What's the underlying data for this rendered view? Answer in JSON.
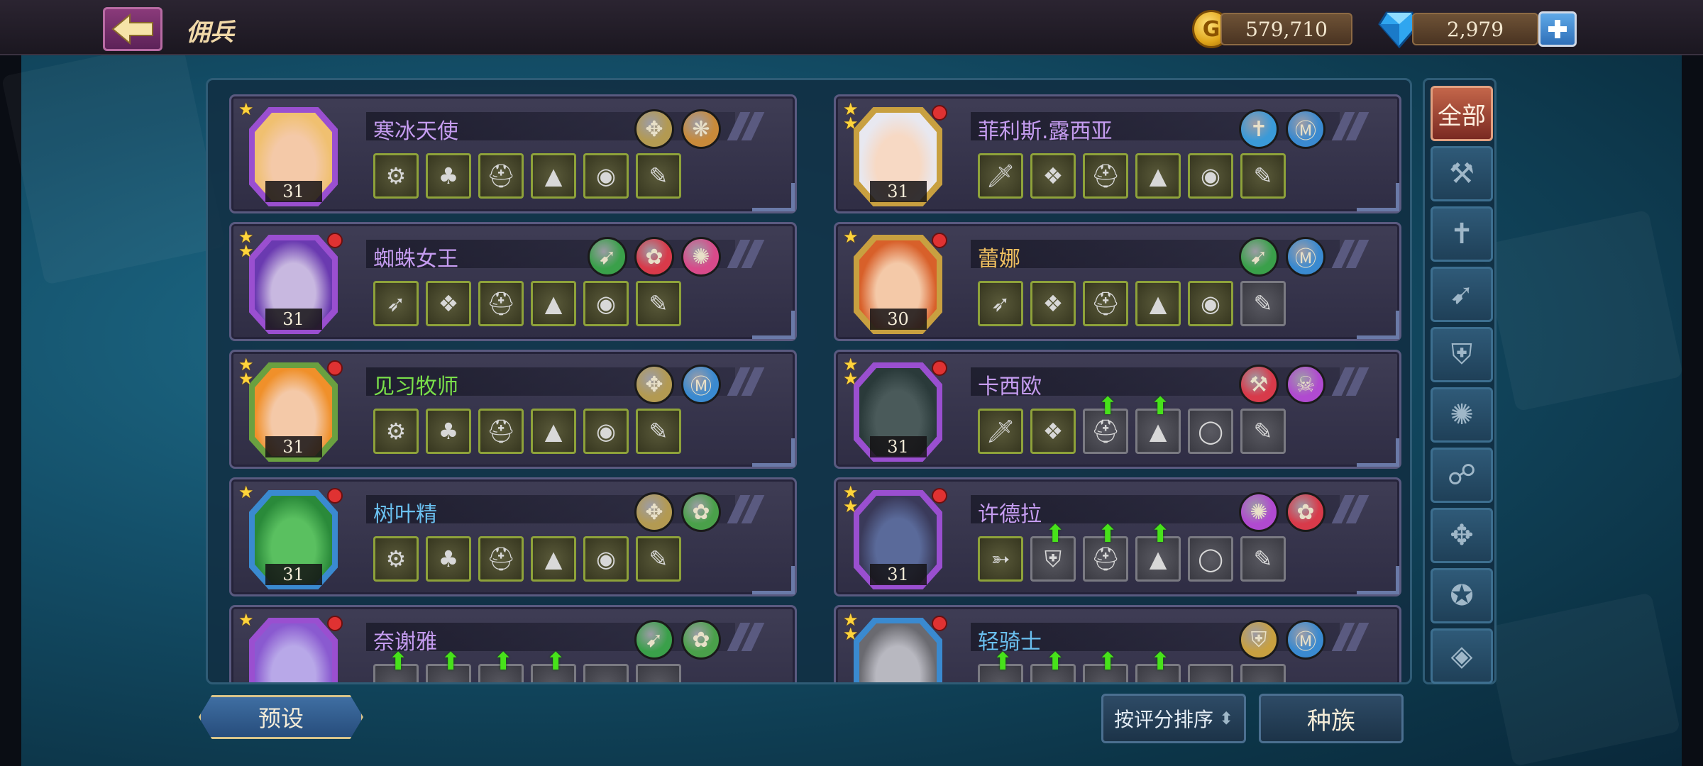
{
  "header": {
    "title": "佣兵",
    "gold": "579,710",
    "gems": "2,979",
    "coin_symbol": "G"
  },
  "heroes": [
    {
      "name": "寒冰天使",
      "level": "31",
      "name_color": "#c59cf0",
      "frame": "#9a4fd0",
      "face": "#f4c9a8",
      "hair": "#f0c070",
      "badges": [
        {
          "icon": "✥",
          "bg": "#b39a52"
        },
        {
          "icon": "❋",
          "bg": "#c88a3a"
        }
      ],
      "slots": [
        {
          "icon": "⚙",
          "up": false,
          "empty": false
        },
        {
          "icon": "♣",
          "up": false,
          "empty": false
        },
        {
          "icon": "⛑",
          "up": false,
          "empty": false
        },
        {
          "icon": "▲",
          "up": false,
          "empty": false
        },
        {
          "icon": "◉",
          "up": false,
          "empty": false
        },
        {
          "icon": "✎",
          "up": false,
          "empty": false
        }
      ]
    },
    {
      "name": "菲利斯.露西亚",
      "level": "31",
      "name_color": "#c59cf0",
      "frame": "#c8a040",
      "face": "#f7d9c4",
      "hair": "#e8e8f0",
      "badges": [
        {
          "icon": "✝",
          "bg": "#3a9ad8"
        },
        {
          "icon": "Ⓜ",
          "bg": "#3a8ad0"
        }
      ],
      "slots": [
        {
          "icon": "🗡",
          "up": false,
          "empty": false
        },
        {
          "icon": "❖",
          "up": false,
          "empty": false
        },
        {
          "icon": "⛑",
          "up": false,
          "empty": false
        },
        {
          "icon": "▲",
          "up": false,
          "empty": false
        },
        {
          "icon": "◉",
          "up": false,
          "empty": false
        },
        {
          "icon": "✎",
          "up": false,
          "empty": false
        }
      ]
    },
    {
      "name": "蜘蛛女王",
      "level": "31",
      "name_color": "#c59cf0",
      "frame": "#9a4fd0",
      "face": "#c8b8e0",
      "hair": "#6a3ab0",
      "badges": [
        {
          "icon": "➹",
          "bg": "#3aa04a"
        },
        {
          "icon": "✿",
          "bg": "#d83a4a"
        },
        {
          "icon": "✺",
          "bg": "#d84a8a"
        }
      ],
      "slots": [
        {
          "icon": "➶",
          "up": false,
          "empty": false
        },
        {
          "icon": "❖",
          "up": false,
          "empty": false
        },
        {
          "icon": "⛑",
          "up": false,
          "empty": false
        },
        {
          "icon": "▲",
          "up": false,
          "empty": false
        },
        {
          "icon": "◉",
          "up": false,
          "empty": false
        },
        {
          "icon": "✎",
          "up": false,
          "empty": false
        }
      ]
    },
    {
      "name": "蕾娜",
      "level": "30",
      "name_color": "#f0c060",
      "frame": "#c8a040",
      "face": "#f4c9a8",
      "hair": "#d8602a",
      "badges": [
        {
          "icon": "➹",
          "bg": "#3aa04a"
        },
        {
          "icon": "Ⓜ",
          "bg": "#3a8ad0"
        }
      ],
      "slots": [
        {
          "icon": "➶",
          "up": false,
          "empty": false
        },
        {
          "icon": "❖",
          "up": false,
          "empty": false
        },
        {
          "icon": "⛑",
          "up": false,
          "empty": false
        },
        {
          "icon": "▲",
          "up": false,
          "empty": false
        },
        {
          "icon": "◉",
          "up": false,
          "empty": false
        },
        {
          "icon": "✎",
          "up": false,
          "empty": true
        }
      ]
    },
    {
      "name": "见习牧师",
      "level": "31",
      "name_color": "#7ae04a",
      "frame": "#6aa040",
      "face": "#f4c9a8",
      "hair": "#f0902a",
      "badges": [
        {
          "icon": "✥",
          "bg": "#b39a52"
        },
        {
          "icon": "Ⓜ",
          "bg": "#3a8ad0"
        }
      ],
      "slots": [
        {
          "icon": "⚙",
          "up": false,
          "empty": false
        },
        {
          "icon": "♣",
          "up": false,
          "empty": false
        },
        {
          "icon": "⛑",
          "up": false,
          "empty": false
        },
        {
          "icon": "▲",
          "up": false,
          "empty": false
        },
        {
          "icon": "◉",
          "up": false,
          "empty": false
        },
        {
          "icon": "✎",
          "up": false,
          "empty": false
        }
      ]
    },
    {
      "name": "卡西欧",
      "level": "31",
      "name_color": "#c59cf0",
      "frame": "#9a4fd0",
      "face": "#4a5a5a",
      "hair": "#2a3a3a",
      "badges": [
        {
          "icon": "⚒",
          "bg": "#d83a4a"
        },
        {
          "icon": "☠",
          "bg": "#b04ad0"
        }
      ],
      "slots": [
        {
          "icon": "🗡",
          "up": false,
          "empty": false
        },
        {
          "icon": "❖",
          "up": false,
          "empty": false
        },
        {
          "icon": "⛑",
          "up": true,
          "empty": true
        },
        {
          "icon": "▲",
          "up": true,
          "empty": true
        },
        {
          "icon": "◯",
          "up": false,
          "empty": true
        },
        {
          "icon": "✎",
          "up": false,
          "empty": true
        }
      ]
    },
    {
      "name": "树叶精",
      "level": "31",
      "name_color": "#6ac0f0",
      "frame": "#3a8ad0",
      "face": "#5ac060",
      "hair": "#2a8a3a",
      "badges": [
        {
          "icon": "✥",
          "bg": "#b39a52"
        },
        {
          "icon": "✿",
          "bg": "#4aa04a"
        }
      ],
      "slots": [
        {
          "icon": "⚙",
          "up": false,
          "empty": false
        },
        {
          "icon": "♣",
          "up": false,
          "empty": false
        },
        {
          "icon": "⛑",
          "up": false,
          "empty": false
        },
        {
          "icon": "▲",
          "up": false,
          "empty": false
        },
        {
          "icon": "◉",
          "up": false,
          "empty": false
        },
        {
          "icon": "✎",
          "up": false,
          "empty": false
        }
      ]
    },
    {
      "name": "许德拉",
      "level": "31",
      "name_color": "#c59cf0",
      "frame": "#9a4fd0",
      "face": "#5a6a9a",
      "hair": "#3a3a5a",
      "badges": [
        {
          "icon": "✺",
          "bg": "#b04ad0"
        },
        {
          "icon": "✿",
          "bg": "#d83a4a"
        }
      ],
      "slots": [
        {
          "icon": "➳",
          "up": false,
          "empty": false
        },
        {
          "icon": "⛨",
          "up": true,
          "empty": true
        },
        {
          "icon": "⛑",
          "up": true,
          "empty": true
        },
        {
          "icon": "▲",
          "up": true,
          "empty": true
        },
        {
          "icon": "◯",
          "up": false,
          "empty": true
        },
        {
          "icon": "✎",
          "up": false,
          "empty": true
        }
      ]
    },
    {
      "name": "奈谢雅",
      "level": "",
      "name_color": "#c59cf0",
      "frame": "#9a4fd0",
      "face": "#b8a8e8",
      "hair": "#8a5ad0",
      "badges": [
        {
          "icon": "➹",
          "bg": "#3aa04a"
        },
        {
          "icon": "✿",
          "bg": "#4aa04a"
        }
      ],
      "slots": [
        {
          "icon": "",
          "up": true,
          "empty": true
        },
        {
          "icon": "",
          "up": true,
          "empty": true
        },
        {
          "icon": "",
          "up": true,
          "empty": true
        },
        {
          "icon": "",
          "up": true,
          "empty": true
        },
        {
          "icon": "",
          "up": false,
          "empty": true
        },
        {
          "icon": "",
          "up": false,
          "empty": true
        }
      ]
    },
    {
      "name": "轻骑士",
      "level": "",
      "name_color": "#6ac0f0",
      "frame": "#3a8ad0",
      "face": "#b8b8c0",
      "hair": "#6a6a70",
      "badges": [
        {
          "icon": "⛨",
          "bg": "#c8a040"
        },
        {
          "icon": "Ⓜ",
          "bg": "#3a8ad0"
        }
      ],
      "slots": [
        {
          "icon": "",
          "up": true,
          "empty": true
        },
        {
          "icon": "",
          "up": true,
          "empty": true
        },
        {
          "icon": "",
          "up": true,
          "empty": true
        },
        {
          "icon": "",
          "up": true,
          "empty": true
        },
        {
          "icon": "",
          "up": false,
          "empty": true
        },
        {
          "icon": "",
          "up": false,
          "empty": true
        }
      ]
    }
  ],
  "tabs": [
    {
      "label": "全部",
      "icon": "",
      "active": true
    },
    {
      "label": "",
      "icon": "⚒",
      "active": false
    },
    {
      "label": "",
      "icon": "✝",
      "active": false
    },
    {
      "label": "",
      "icon": "➹",
      "active": false
    },
    {
      "label": "",
      "icon": "⛨",
      "active": false
    },
    {
      "label": "",
      "icon": "✺",
      "active": false
    },
    {
      "label": "",
      "icon": "☍",
      "active": false
    },
    {
      "label": "",
      "icon": "✥",
      "active": false
    },
    {
      "label": "",
      "icon": "✪",
      "active": false
    },
    {
      "label": "",
      "icon": "◈",
      "active": false
    }
  ],
  "footer": {
    "preset": "预设",
    "sort": "按评分排序",
    "sort_arrow": "⬍",
    "race": "种族"
  }
}
